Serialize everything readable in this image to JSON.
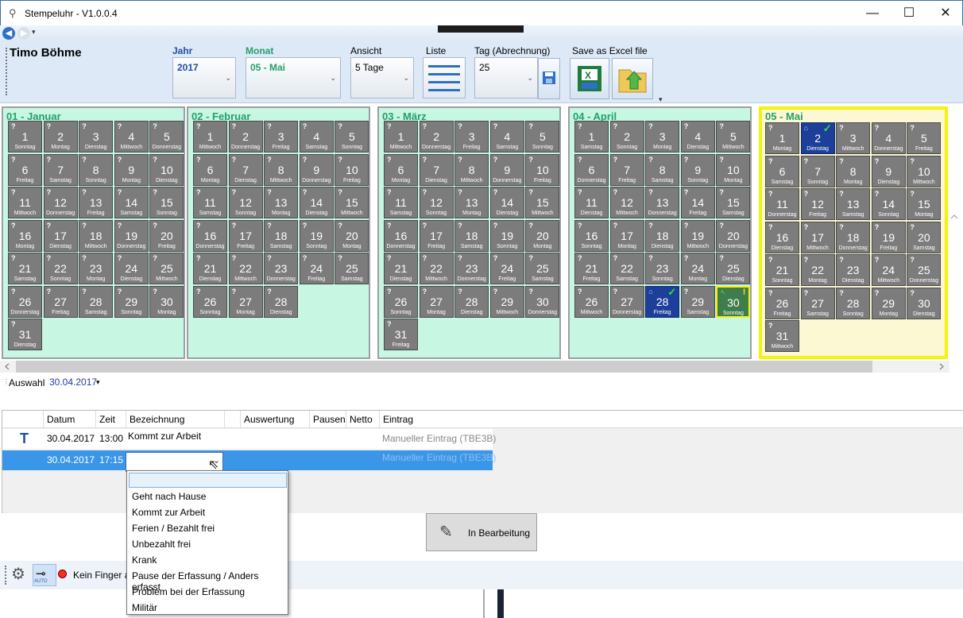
{
  "window": {
    "title": "Stempeluhr - V1.0.0.4",
    "minimize_glyph": "—",
    "maximize_glyph": "☐",
    "close_glyph": "✕"
  },
  "quick_access": {
    "back_glyph": "◀",
    "forward_glyph": "▶",
    "dropdown_glyph": "▾"
  },
  "ribbon": {
    "user": "Timo Böhme",
    "jahr": {
      "label": "Jahr",
      "value": "2017"
    },
    "monat": {
      "label": "Monat",
      "value": "05 - Mai"
    },
    "ansicht": {
      "label": "Ansicht",
      "value": "5 Tage"
    },
    "liste": {
      "label": "Liste"
    },
    "tag": {
      "label": "Tag (Abrechnung)",
      "value": "25"
    },
    "excel": {
      "label": "Save as Excel file"
    },
    "chevron": "⌄",
    "collapse_glyph": "▾"
  },
  "calendar": {
    "q": "?",
    "months": [
      {
        "title": "01 - Januar",
        "first_dow": 0,
        "days": 31,
        "selected": false
      },
      {
        "title": "02 - Februar",
        "first_dow": 3,
        "days": 28,
        "selected": false
      },
      {
        "title": "03 - März",
        "first_dow": 3,
        "days": 31,
        "selected": false
      },
      {
        "title": "04 - April",
        "first_dow": 6,
        "days": 30,
        "selected": false,
        "marked": {
          "28": "blue",
          "30": "yellow"
        }
      },
      {
        "title": "05 - Mai",
        "first_dow": 1,
        "days": 31,
        "selected": true,
        "marked": {
          "2": "blue"
        }
      }
    ],
    "weekday_names": [
      "Sonntag",
      "Montag",
      "Dienstag",
      "Mittwoch",
      "Donnerstag",
      "Freitag",
      "Samstag"
    ]
  },
  "auswahl": {
    "label": "Auswahl",
    "value": "30.04.2017",
    "chevron": "▾"
  },
  "grid": {
    "columns": [
      "Datum",
      "Zeit",
      "Bezeichnung",
      "Auswertung",
      "Pausen",
      "Netto",
      "Eintrag"
    ],
    "rows": [
      {
        "icon": "T",
        "datum": "30.04.2017",
        "zeit": "13:00",
        "bezeichnung": "Kommt zur Arbeit",
        "eintrag": "Manueller Eintrag (TBE3B)"
      },
      {
        "icon": "",
        "datum": "30.04.2017",
        "zeit": "17:15",
        "bezeichnung": "",
        "eintrag": "Manueller Eintrag (TBE3B)"
      }
    ],
    "combo_arrow": "⌄"
  },
  "dropdown": {
    "items": [
      "Geht nach Hause",
      "Kommt zur Arbeit",
      "Ferien / Bezahlt frei",
      "Unbezahlt frei",
      "Krank",
      "Pause der Erfassung / Anders erfasst",
      "Problem bei der Erfassung",
      "Militär"
    ]
  },
  "edit_button": {
    "label": "In Bearbeitung"
  },
  "statusbar": {
    "text": "Kein Finger a",
    "auto": "AUTO"
  },
  "colors": {
    "accent_green": "#24a06b",
    "selected_row": "#3a96e8",
    "day_gray": "#7c7c7c",
    "day_blue": "#1d3f99",
    "highlight_yellow": "#f3f30e"
  }
}
